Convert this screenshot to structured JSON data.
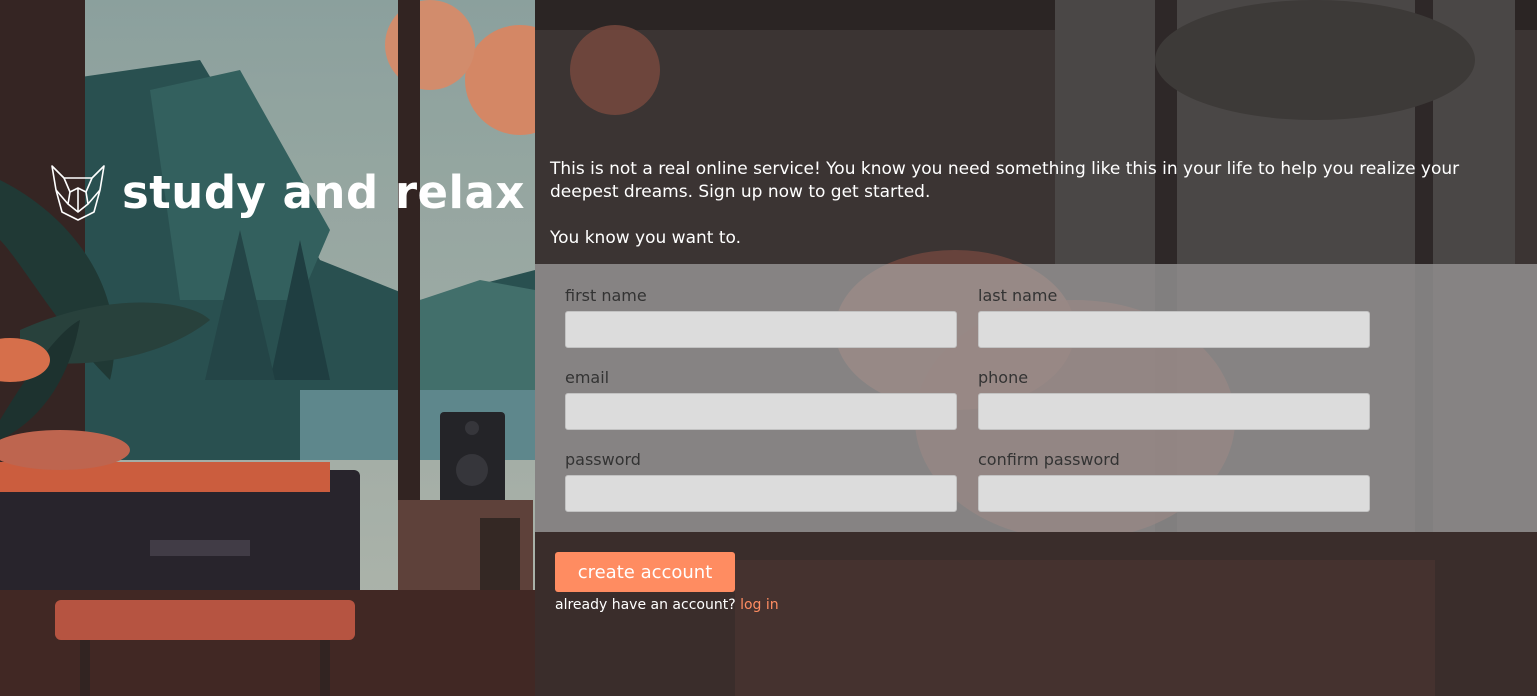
{
  "brand": {
    "title": "study and relax",
    "logo_icon": "bulldog-logo-icon"
  },
  "intro": {
    "paragraph1": "This is not a real online service! You know you need something like this in your life to help you realize your deepest dreams. Sign up now to get started.",
    "paragraph2": "You know you want to."
  },
  "form": {
    "first_name": {
      "label": "first name",
      "value": "",
      "placeholder": ""
    },
    "last_name": {
      "label": "last name",
      "value": "",
      "placeholder": ""
    },
    "email": {
      "label": "email",
      "value": "",
      "placeholder": ""
    },
    "phone": {
      "label": "phone",
      "value": "",
      "placeholder": ""
    },
    "password": {
      "label": "password",
      "value": "",
      "placeholder": ""
    },
    "confirm_password": {
      "label": "confirm password",
      "value": "",
      "placeholder": ""
    }
  },
  "actions": {
    "create_label": "create account",
    "login_prompt": "already have an account?",
    "login_link": "log in"
  },
  "colors": {
    "accent": "#ff8c61",
    "form_band": "#b4b4b4",
    "input_bg": "#dcdcdc"
  }
}
